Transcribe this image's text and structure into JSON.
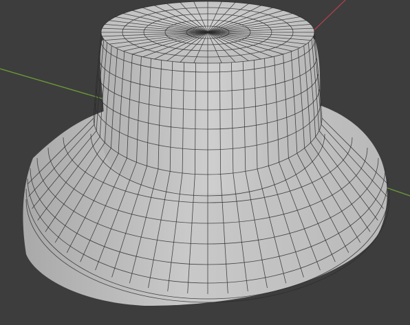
{
  "viewport": {
    "background": "#3d3d3d",
    "mesh_color": "#c4c4c4",
    "wire_color": "#2a2a2a",
    "axis_x_color": "#a8404f",
    "axis_y_color": "#6b9a38",
    "object": "bucket-hat-mesh",
    "shading": "solid-with-wireframe"
  }
}
